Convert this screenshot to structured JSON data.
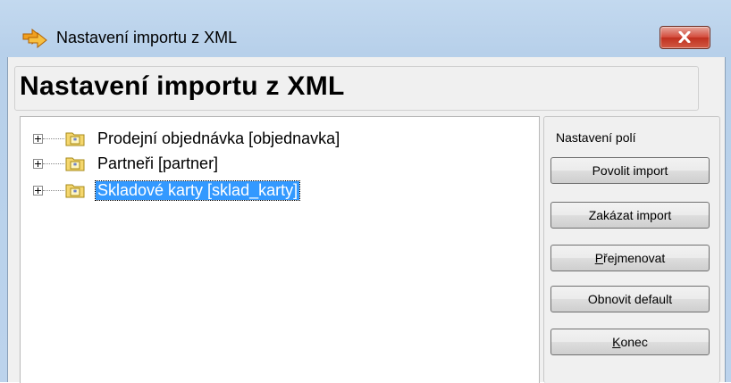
{
  "window": {
    "title": "Nastavení importu z XML",
    "close_label": "x"
  },
  "header": {
    "title": "Nastavení importu z XML"
  },
  "tree": {
    "nodes": [
      {
        "label": "Prodejní objednávka [objednavka]",
        "selected": false
      },
      {
        "label": "Partneři [partner]",
        "selected": false
      },
      {
        "label": "Skladové karty [sklad_karty]",
        "selected": true
      }
    ]
  },
  "side": {
    "title": "Nastavení polí",
    "buttons": {
      "enable": "Povolit import",
      "disable": "Zakázat import",
      "rename_mnemonic": "P",
      "rename_rest": "řejmenovat",
      "reset": "Obnovit default",
      "close_mnemonic": "K",
      "close_rest": "onec"
    }
  },
  "colors": {
    "selection": "#3399ff",
    "close_button": "#c0301f",
    "frame": "#bcd3ec"
  }
}
